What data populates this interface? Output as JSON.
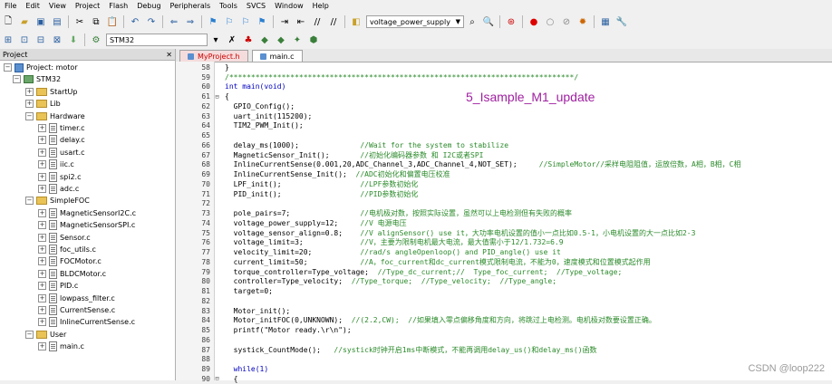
{
  "menu": [
    "File",
    "Edit",
    "View",
    "Project",
    "Flash",
    "Debug",
    "Peripherals",
    "Tools",
    "SVCS",
    "Window",
    "Help"
  ],
  "toolbar": {
    "target_combo": "voltage_power_supply",
    "target_select": "STM32"
  },
  "project_panel": {
    "title": "Project",
    "close": "✕",
    "tree": [
      {
        "label": "Project: motor",
        "level": 0,
        "kind": "proj",
        "exp": "−"
      },
      {
        "label": "STM32",
        "level": 1,
        "kind": "target",
        "exp": "−"
      },
      {
        "label": "StartUp",
        "level": 2,
        "kind": "folder",
        "exp": "+"
      },
      {
        "label": "Lib",
        "level": 2,
        "kind": "folder",
        "exp": "+"
      },
      {
        "label": "Hardware",
        "level": 2,
        "kind": "folder",
        "exp": "−"
      },
      {
        "label": "timer.c",
        "level": 3,
        "kind": "file",
        "exp": "+"
      },
      {
        "label": "delay.c",
        "level": 3,
        "kind": "file",
        "exp": "+"
      },
      {
        "label": "usart.c",
        "level": 3,
        "kind": "file",
        "exp": "+"
      },
      {
        "label": "iic.c",
        "level": 3,
        "kind": "file",
        "exp": "+"
      },
      {
        "label": "spi2.c",
        "level": 3,
        "kind": "file",
        "exp": "+"
      },
      {
        "label": "adc.c",
        "level": 3,
        "kind": "file",
        "exp": "+"
      },
      {
        "label": "SimpleFOC",
        "level": 2,
        "kind": "folder",
        "exp": "−"
      },
      {
        "label": "MagneticSensorI2C.c",
        "level": 3,
        "kind": "file",
        "exp": "+"
      },
      {
        "label": "MagneticSensorSPI.c",
        "level": 3,
        "kind": "file",
        "exp": "+"
      },
      {
        "label": "Sensor.c",
        "level": 3,
        "kind": "file",
        "exp": "+"
      },
      {
        "label": "foc_utils.c",
        "level": 3,
        "kind": "file",
        "exp": "+"
      },
      {
        "label": "FOCMotor.c",
        "level": 3,
        "kind": "file",
        "exp": "+"
      },
      {
        "label": "BLDCMotor.c",
        "level": 3,
        "kind": "file",
        "exp": "+"
      },
      {
        "label": "PID.c",
        "level": 3,
        "kind": "file",
        "exp": "+"
      },
      {
        "label": "lowpass_filter.c",
        "level": 3,
        "kind": "file",
        "exp": "+"
      },
      {
        "label": "CurrentSense.c",
        "level": 3,
        "kind": "file",
        "exp": "+"
      },
      {
        "label": "InlineCurrentSense.c",
        "level": 3,
        "kind": "file",
        "exp": "+"
      },
      {
        "label": "User",
        "level": 2,
        "kind": "folder",
        "exp": "−"
      },
      {
        "label": "main.c",
        "level": 3,
        "kind": "file",
        "exp": "+"
      }
    ]
  },
  "editor": {
    "tabs": [
      {
        "label": "MyProject.h"
      },
      {
        "label": "main.c"
      }
    ],
    "lines": [
      {
        "n": "58",
        "fold": "",
        "code": "}",
        "cm": ""
      },
      {
        "n": "59",
        "fold": "",
        "code": "",
        "cm": "/*******************************************************************************/"
      },
      {
        "n": "60",
        "fold": "",
        "code": "int main(void)",
        "cm": ""
      },
      {
        "n": "61",
        "fold": "⊟",
        "code": "{",
        "cm": ""
      },
      {
        "n": "62",
        "fold": "",
        "code": "  GPIO_Config();",
        "cm": ""
      },
      {
        "n": "63",
        "fold": "",
        "code": "  uart_init(115200);",
        "cm": ""
      },
      {
        "n": "64",
        "fold": "",
        "code": "  TIM2_PWM_Init();",
        "cm": ""
      },
      {
        "n": "65",
        "fold": "",
        "code": "",
        "cm": ""
      },
      {
        "n": "66",
        "fold": "",
        "code": "  delay_ms(1000);              ",
        "cm": "//Wait for the system to stabilize"
      },
      {
        "n": "67",
        "fold": "",
        "code": "  MagneticSensor_Init();       ",
        "cm": "//初始化编码器参数 和 I2C或者SPI"
      },
      {
        "n": "68",
        "fold": "",
        "code": "  InlineCurrentSense(0.001,20,ADC_Channel_3,ADC_Channel_4,NOT_SET);     ",
        "cm": "//SimpleMotor//采样电阻阻值，运放倍数，A相，B相，C相"
      },
      {
        "n": "69",
        "fold": "",
        "code": "  InlineCurrentSense_Init();  ",
        "cm": "//ADC初始化和偏置电压校准"
      },
      {
        "n": "70",
        "fold": "",
        "code": "  LPF_init();                  ",
        "cm": "//LPF参数初始化"
      },
      {
        "n": "71",
        "fold": "",
        "code": "  PID_init();                  ",
        "cm": "//PID参数初始化"
      },
      {
        "n": "72",
        "fold": "",
        "code": "",
        "cm": ""
      },
      {
        "n": "73",
        "fold": "",
        "code": "  pole_pairs=7;                ",
        "cm": "//电机极对数，按照实际设置，虽然可以上电检测但有失败的概率"
      },
      {
        "n": "74",
        "fold": "",
        "code": "  voltage_power_supply=12;     ",
        "cm": "//V 电源电压"
      },
      {
        "n": "75",
        "fold": "",
        "code": "  voltage_sensor_align=0.8;    ",
        "cm": "//V alignSensor() use it，大功率电机设置的值小一点比如0.5-1，小电机设置的大一点比如2-3"
      },
      {
        "n": "76",
        "fold": "",
        "code": "  voltage_limit=3;             ",
        "cm": "//V，主要为限制电机最大电流，最大值需小于12/1.732=6.9"
      },
      {
        "n": "77",
        "fold": "",
        "code": "  velocity_limit=20;           ",
        "cm": "//rad/s angleOpenloop() and PID_angle() use it"
      },
      {
        "n": "78",
        "fold": "",
        "code": "  current_limit=50;            ",
        "cm": "//A，foc_current和dc_current模式限制电流，不能为0，速度模式和位置模式起作用"
      },
      {
        "n": "79",
        "fold": "",
        "code": "  torque_controller=Type_voltage;  ",
        "cm": "//Type_dc_current;//  Type_foc_current;  //Type_voltage;"
      },
      {
        "n": "80",
        "fold": "",
        "code": "  controller=Type_velocity;  ",
        "cm": "//Type_torque;  //Type_velocity;  //Type_angle;"
      },
      {
        "n": "81",
        "fold": "",
        "code": "  target=0;",
        "cm": ""
      },
      {
        "n": "82",
        "fold": "",
        "code": "",
        "cm": ""
      },
      {
        "n": "83",
        "fold": "",
        "code": "  Motor_init();",
        "cm": ""
      },
      {
        "n": "84",
        "fold": "",
        "code": "  Motor_initFOC(0,UNKNOWN);  ",
        "cm": "//(2.2,CW);  //如果填入零点偏移角度和方向，将跳过上电检测。电机极对数要设置正确。"
      },
      {
        "n": "85",
        "fold": "",
        "code": "  printf(\"Motor ready.\\r\\n\");",
        "cm": ""
      },
      {
        "n": "86",
        "fold": "",
        "code": "",
        "cm": ""
      },
      {
        "n": "87",
        "fold": "",
        "code": "  systick_CountMode();   ",
        "cm": "//systick时钟开启1ms中断模式，不能再调用delay_us()和delay_ms()函数"
      },
      {
        "n": "88",
        "fold": "",
        "code": "",
        "cm": ""
      },
      {
        "n": "89",
        "fold": "",
        "code": "  while(1)",
        "cm": ""
      },
      {
        "n": "90",
        "fold": "⊟",
        "code": "  {",
        "cm": ""
      }
    ]
  },
  "overlay_label": "5_Isample_M1_update",
  "watermark": "CSDN @loop222"
}
